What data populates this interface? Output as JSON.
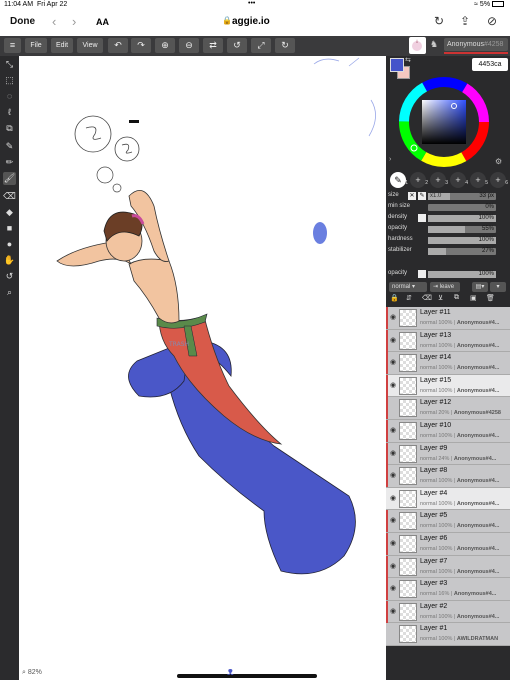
{
  "status": {
    "time": "11:04 AM",
    "date": "Fri Apr 22",
    "battery": "5%"
  },
  "safari": {
    "done": "Done",
    "aa": "AA",
    "url": "aggie.io",
    "back": "‹",
    "forward": "›"
  },
  "menu": {
    "file": "File",
    "edit": "Edit",
    "view": "View"
  },
  "user": {
    "name": "Anonymous",
    "id": "#4258"
  },
  "color": {
    "hex": "4453ca",
    "primary": "#4453ca",
    "secondary": "#f4c8c0"
  },
  "brush": {
    "sizes": [
      "1",
      "2",
      "3",
      "4",
      "5",
      "6"
    ],
    "size": {
      "label": "size",
      "preset": "x1.0",
      "value": "33 px",
      "fraction": 0.33
    },
    "min_size": {
      "label": "min size",
      "value": "0%",
      "fraction": 0
    },
    "density": {
      "label": "density",
      "value": "100%",
      "fraction": 1
    },
    "opacity": {
      "label": "opacity",
      "value": "55%",
      "fraction": 0.55
    },
    "hardness": {
      "label": "hardness",
      "value": "100%",
      "fraction": 1
    },
    "stabilizer": {
      "label": "stabilizer",
      "value": "27%",
      "fraction": 0.27
    }
  },
  "layer_opacity": {
    "label": "opacity",
    "value": "100%",
    "fraction": 1
  },
  "layer_controls": {
    "blend": "normal",
    "leave": "leave"
  },
  "layers": [
    {
      "name": "Layer #11",
      "mode": "normal",
      "opacity": "100%",
      "owner": "Anonymous#4...",
      "visible": true,
      "selected": false,
      "mark": true
    },
    {
      "name": "Layer #13",
      "mode": "normal",
      "opacity": "100%",
      "owner": "Anonymous#4...",
      "visible": true,
      "selected": false,
      "mark": true
    },
    {
      "name": "Layer #14",
      "mode": "normal",
      "opacity": "100%",
      "owner": "Anonymous#4...",
      "visible": true,
      "selected": false,
      "mark": true
    },
    {
      "name": "Layer #15",
      "mode": "normal",
      "opacity": "100%",
      "owner": "Anonymous#4...",
      "visible": true,
      "selected": true,
      "mark": true
    },
    {
      "name": "Layer #12",
      "mode": "normal",
      "opacity": "20%",
      "owner": "Anonymous#4258",
      "visible": false,
      "selected": false,
      "mark": true
    },
    {
      "name": "Layer #10",
      "mode": "normal",
      "opacity": "100%",
      "owner": "Anonymous#4...",
      "visible": true,
      "selected": false,
      "mark": true
    },
    {
      "name": "Layer #9",
      "mode": "normal",
      "opacity": "24%",
      "owner": "Anonymous#4...",
      "visible": true,
      "selected": false,
      "mark": true
    },
    {
      "name": "Layer #8",
      "mode": "normal",
      "opacity": "100%",
      "owner": "Anonymous#4...",
      "visible": true,
      "selected": false,
      "mark": true
    },
    {
      "name": "Layer #4",
      "mode": "normal",
      "opacity": "100%",
      "owner": "Anonymous#4...",
      "visible": true,
      "selected": true,
      "mark": false
    },
    {
      "name": "Layer #5",
      "mode": "normal",
      "opacity": "100%",
      "owner": "Anonymous#4...",
      "visible": true,
      "selected": false,
      "mark": true
    },
    {
      "name": "Layer #6",
      "mode": "normal",
      "opacity": "100%",
      "owner": "Anonymous#4...",
      "visible": true,
      "selected": false,
      "mark": true
    },
    {
      "name": "Layer #7",
      "mode": "normal",
      "opacity": "100%",
      "owner": "Anonymous#4...",
      "visible": true,
      "selected": false,
      "mark": true
    },
    {
      "name": "Layer #3",
      "mode": "normal",
      "opacity": "16%",
      "owner": "Anonymous#4...",
      "visible": true,
      "selected": false,
      "mark": true
    },
    {
      "name": "Layer #2",
      "mode": "normal",
      "opacity": "100%",
      "owner": "Anonymous#4...",
      "visible": true,
      "selected": false,
      "mark": true
    },
    {
      "name": "Layer #1",
      "mode": "normal",
      "opacity": "100%",
      "owner": "AWILDRATMAN",
      "visible": false,
      "selected": false,
      "mark": false
    }
  ],
  "zoom": "82%"
}
